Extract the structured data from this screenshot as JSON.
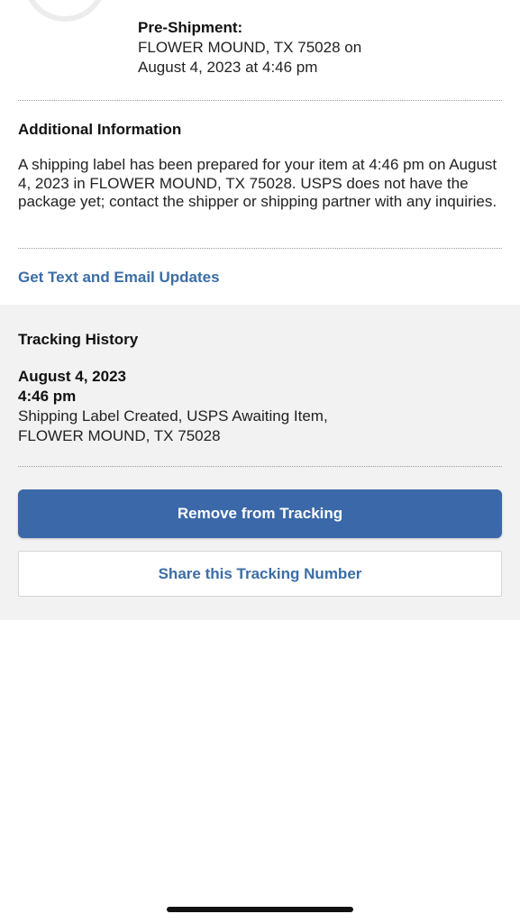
{
  "status": {
    "title": "Pre-Shipment:",
    "location": "FLOWER MOUND, TX 75028 on",
    "datetime": "August 4, 2023 at 4:46 pm"
  },
  "additional_info": {
    "title": "Additional Information",
    "body": "A shipping label has been prepared for your item at 4:46 pm on August 4, 2023 in FLOWER MOUND, TX 75028. USPS does not have the package yet; contact the shipper or shipping partner with any inquiries."
  },
  "updates_link": "Get Text and Email Updates",
  "tracking_history": {
    "title": "Tracking History",
    "entries": [
      {
        "date": "August 4, 2023",
        "time": "4:46 pm",
        "description": "Shipping Label Created, USPS Awaiting Item,",
        "location": "FLOWER MOUND, TX 75028"
      }
    ]
  },
  "actions": {
    "remove_label": "Remove from Tracking",
    "share_label": "Share this Tracking Number"
  },
  "colors": {
    "accent_blue": "#3b68a8",
    "link_blue": "#3b6ea6",
    "panel_gray": "#f2f2f2"
  }
}
